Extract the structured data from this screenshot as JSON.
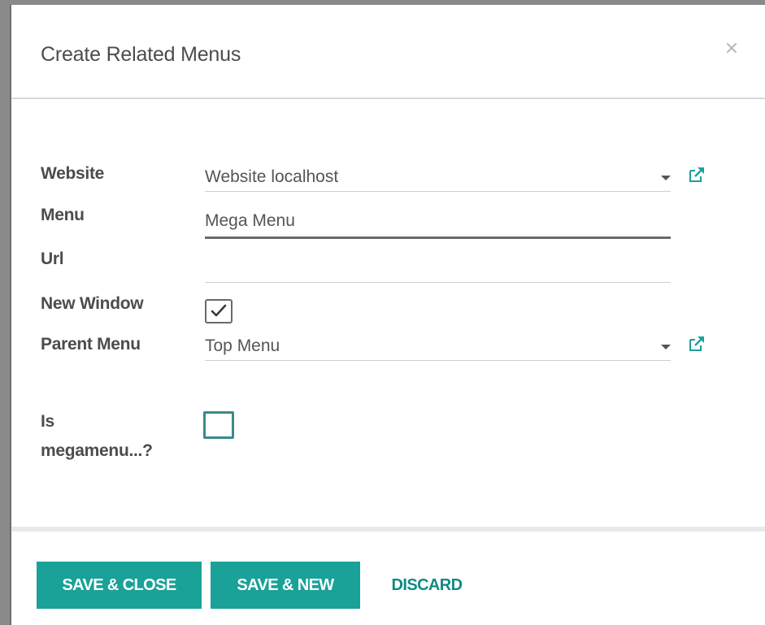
{
  "dialog": {
    "title": "Create Related Menus",
    "close_icon": "close-icon"
  },
  "form": {
    "website": {
      "label": "Website",
      "value": "Website localhost",
      "icons": [
        "chevron-down-icon",
        "external-link-icon"
      ]
    },
    "menu": {
      "label": "Menu",
      "value": "Mega Menu"
    },
    "url": {
      "label": "Url",
      "value": ""
    },
    "new_window": {
      "label": "New Window",
      "checked": true
    },
    "parent_menu": {
      "label": "Parent Menu",
      "value": "Top Menu",
      "icons": [
        "chevron-down-icon",
        "external-link-icon"
      ]
    },
    "is_megamenu": {
      "label_line1": "Is",
      "label_line2": "megamenu...?",
      "checked": false
    }
  },
  "footer": {
    "save_close_label": "SAVE & CLOSE",
    "save_new_label": "SAVE & NEW",
    "discard_label": "DISCARD"
  },
  "colors": {
    "primary": "#1aa198",
    "link": "#118a83",
    "checkbox_focus_border": "#3a8a8a"
  }
}
